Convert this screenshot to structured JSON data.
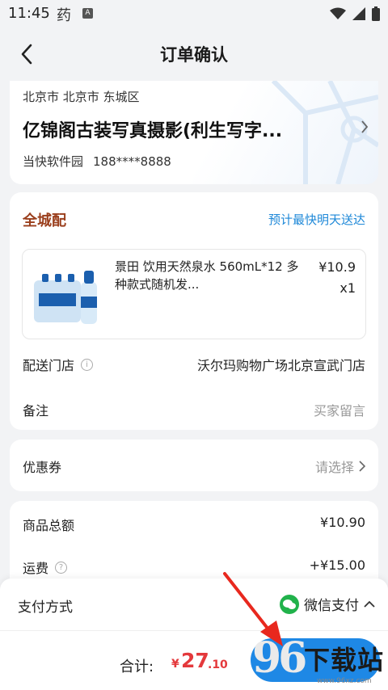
{
  "status_bar": {
    "time": "11:45",
    "app_char": "药",
    "notif_letter": "A"
  },
  "nav": {
    "title": "订单确认"
  },
  "address": {
    "region": "北京市 北京市 东城区",
    "name": "亿锦阁古装写真摄影(利生写字...",
    "contact_name": "当快软件园",
    "phone": "188****8888"
  },
  "order": {
    "delivery_type": "全城配",
    "eta": "预计最快明天送达",
    "product": {
      "name": "景田 饮用天然泉水 560mL*12 多种款式随机发...",
      "price": "¥10.9",
      "qty": "x1"
    },
    "store_label": "配送门店",
    "store_value": "沃尔玛购物广场北京宣武门店",
    "remark_label": "备注",
    "remark_placeholder": "买家留言"
  },
  "coupon": {
    "label": "优惠券",
    "value": "请选择"
  },
  "totals": {
    "goods_label": "商品总额",
    "goods_value": "¥10.90",
    "shipping_label": "运费",
    "shipping_value": "+¥15.00"
  },
  "payment": {
    "label": "支付方式",
    "method": "微信支付"
  },
  "footer": {
    "total_label": "合计:",
    "currency": "¥",
    "total_integer": "27",
    "total_decimal": ".10"
  },
  "watermark": {
    "logo": "96",
    "text": "下载站",
    "url": "www.96xz.com"
  },
  "colors": {
    "accent": "#1e88e5",
    "price": "#e4393c",
    "delivery_type": "#9a3e1c",
    "eta": "#1e88d8",
    "wechat": "#21b24b",
    "annotation_arrow": "#e8281e"
  }
}
